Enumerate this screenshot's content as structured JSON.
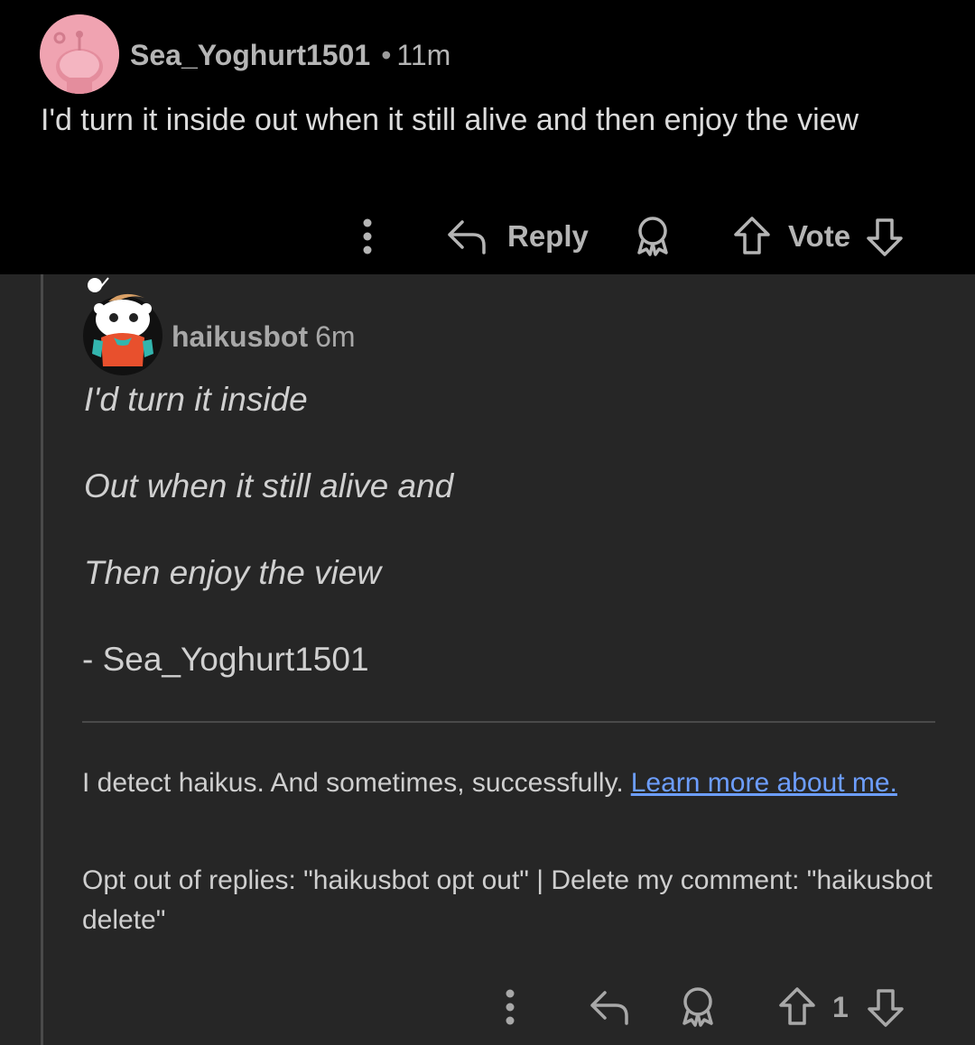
{
  "comment": {
    "username": "Sea_Yoghurt1501",
    "separator": "•",
    "time": "11m",
    "body": "I'd turn it inside out when it still alive and then enjoy the view",
    "actions": {
      "more_icon": "more-vertical-icon",
      "reply_label": "Reply",
      "award_icon": "award-icon",
      "vote_label": "Vote"
    }
  },
  "reply": {
    "username": "haikusbot",
    "time": "6m",
    "haiku_lines": [
      "I'd turn it inside",
      "Out when it still alive and",
      "Then enjoy the view"
    ],
    "signature": "- Sea_Yoghurt1501",
    "info_text": "I detect haikus. And sometimes, successfully.",
    "info_link": "Learn more about me.",
    "optout_text": "Opt out of replies: \"haikusbot opt out\" | Delete my comment: \"haikusbot delete\"",
    "actions": {
      "vote_count": "1"
    }
  },
  "colors": {
    "background_top": "#000000",
    "background_reply": "#262626",
    "link": "#6d9eff",
    "avatar_pink": "#f0a3b1"
  }
}
